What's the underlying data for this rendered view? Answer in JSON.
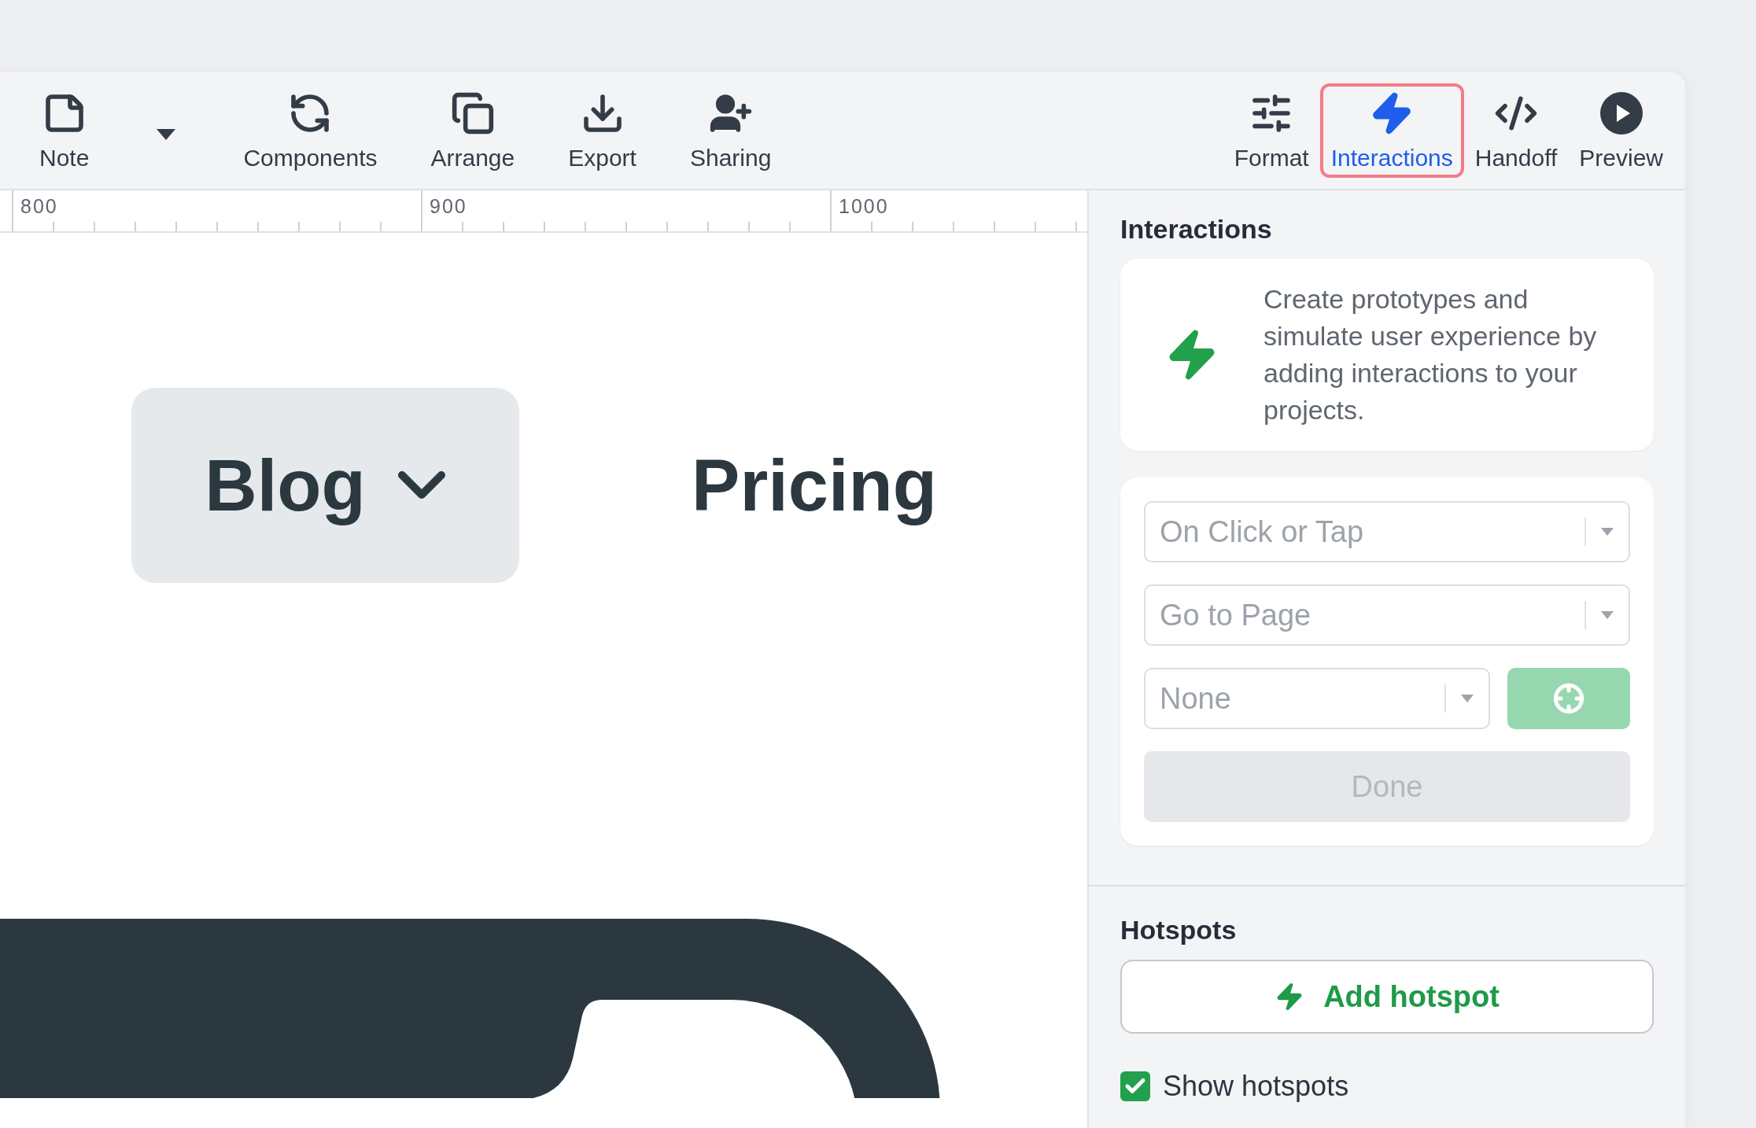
{
  "toolbar": {
    "left": [
      {
        "kind": "note",
        "label": "Note",
        "selected": false,
        "has_menu": true
      },
      {
        "kind": "components",
        "label": "Components",
        "selected": false,
        "has_menu": false
      },
      {
        "kind": "arrange",
        "label": "Arrange",
        "selected": false,
        "has_menu": false
      },
      {
        "kind": "export",
        "label": "Export",
        "selected": false,
        "has_menu": false
      },
      {
        "kind": "sharing",
        "label": "Sharing",
        "selected": false,
        "has_menu": false
      }
    ],
    "right": [
      {
        "kind": "format",
        "label": "Format",
        "selected": false,
        "has_menu": false
      },
      {
        "kind": "interactions",
        "label": "Interactions",
        "selected": true,
        "has_menu": false
      },
      {
        "kind": "handoff",
        "label": "Handoff",
        "selected": false,
        "has_menu": false
      },
      {
        "kind": "preview",
        "label": "Preview",
        "selected": false,
        "has_menu": false
      }
    ]
  },
  "ruler": {
    "labels": [
      "800",
      "900",
      "1000"
    ]
  },
  "canvas": {
    "nav_items": [
      {
        "label": "Blog",
        "has_dropdown": true,
        "highlighted": true
      },
      {
        "label": "Pricing",
        "has_dropdown": false,
        "highlighted": false
      }
    ]
  },
  "interactions": {
    "title": "Interactions",
    "info": "Create prototypes and simulate user experience by adding interactions to your projects.",
    "trigger": {
      "value": "On Click or Tap"
    },
    "action": {
      "value": "Go to Page"
    },
    "target": {
      "value": "None"
    },
    "done": {
      "label": "Done",
      "disabled": true
    }
  },
  "hotspots": {
    "title": "Hotspots",
    "add_button": "Add hotspot",
    "show": {
      "label": "Show hotspots",
      "checked": true
    }
  }
}
